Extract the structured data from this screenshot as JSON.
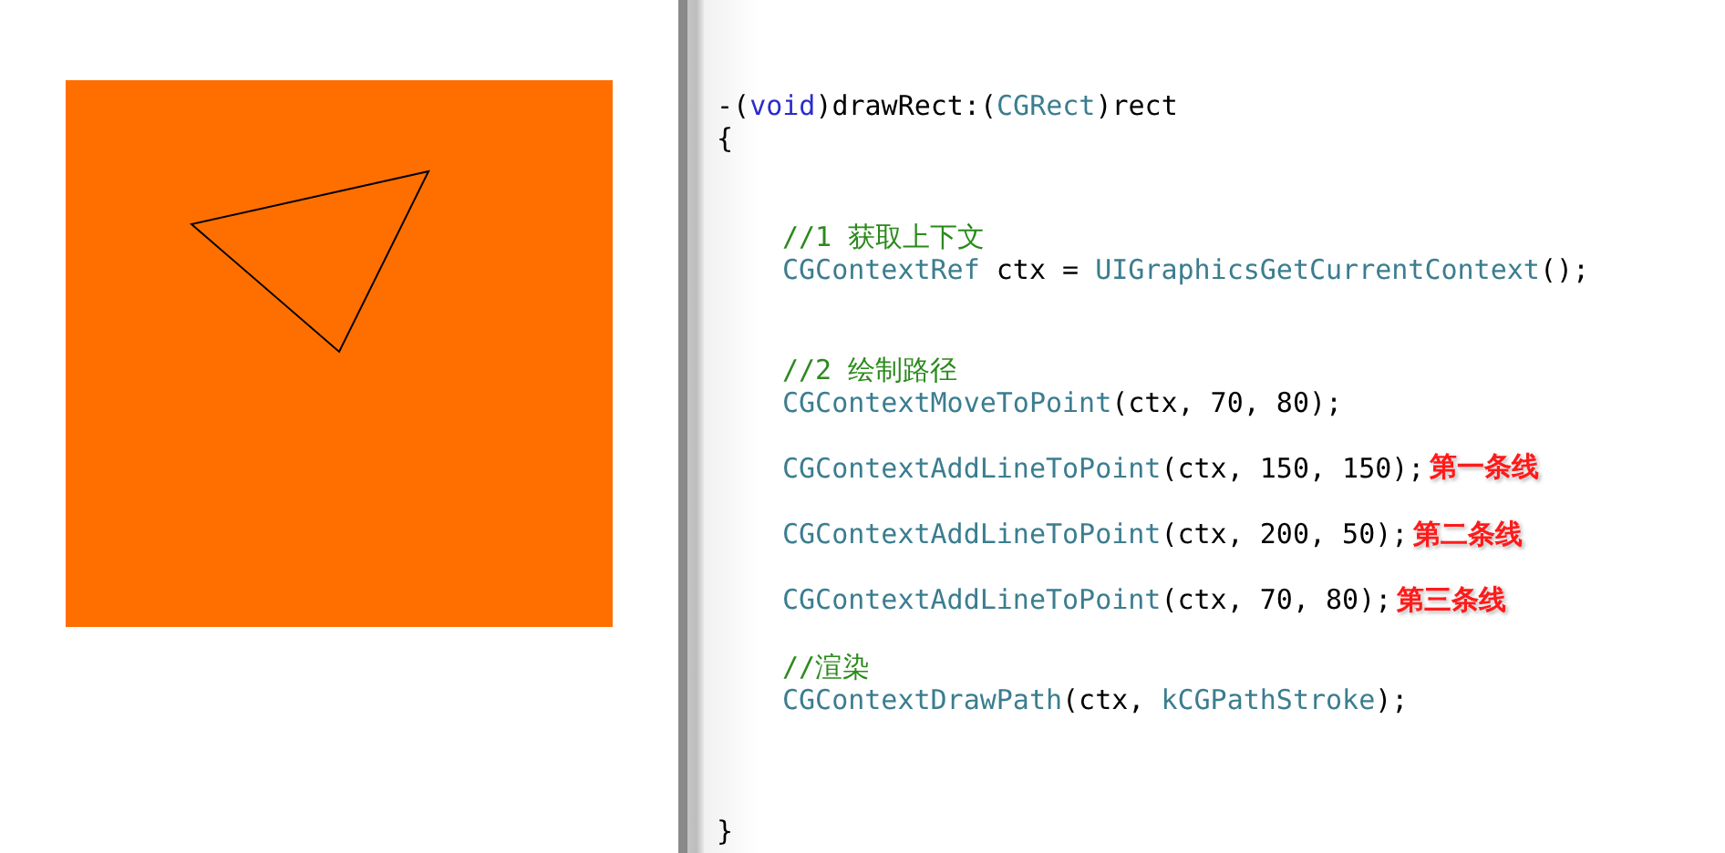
{
  "editor": {
    "lines": [
      {
        "kind": "code",
        "tokens": [
          {
            "kind": "plain",
            "text": "-("
          },
          {
            "kind": "keyword",
            "text": "void"
          },
          {
            "kind": "plain",
            "text": ")drawRect:("
          },
          {
            "kind": "type",
            "text": "CGRect"
          },
          {
            "kind": "plain",
            "text": ")rect"
          }
        ]
      },
      {
        "kind": "code",
        "tokens": [
          {
            "kind": "plain",
            "text": "{"
          }
        ],
        "children": [
          {
            "kind": "blank"
          },
          {
            "kind": "blank"
          },
          {
            "kind": "code",
            "tokens": [
              {
                "kind": "comment",
                "text": "//1 获取上下文"
              }
            ]
          },
          {
            "kind": "code",
            "tokens": [
              {
                "kind": "type",
                "text": "CGContextRef"
              },
              {
                "kind": "plain",
                "text": " ctx = "
              },
              {
                "kind": "type",
                "text": "UIGraphicsGetCurrentContext"
              },
              {
                "kind": "plain",
                "text": "();"
              }
            ]
          },
          {
            "kind": "blank"
          },
          {
            "kind": "blank"
          },
          {
            "kind": "code",
            "tokens": [
              {
                "kind": "comment",
                "text": "//2 绘制路径"
              }
            ]
          },
          {
            "kind": "code",
            "tokens": [
              {
                "kind": "type",
                "text": "CGContextMoveToPoint"
              },
              {
                "kind": "plain",
                "text": "(ctx, 70, 80);"
              }
            ]
          },
          {
            "kind": "blank"
          },
          {
            "kind": "code",
            "tokens": [
              {
                "kind": "type",
                "text": "CGContextAddLineToPoint"
              },
              {
                "kind": "plain",
                "text": "(ctx, 150, 150);"
              }
            ],
            "note": "第一条线"
          },
          {
            "kind": "blank"
          },
          {
            "kind": "code",
            "tokens": [
              {
                "kind": "type",
                "text": "CGContextAddLineToPoint"
              },
              {
                "kind": "plain",
                "text": "(ctx, 200, 50);"
              }
            ],
            "note": "第二条线"
          },
          {
            "kind": "blank"
          },
          {
            "kind": "code",
            "tokens": [
              {
                "kind": "type",
                "text": "CGContextAddLineToPoint"
              },
              {
                "kind": "plain",
                "text": "(ctx, 70, 80);"
              }
            ],
            "note": "第三条线"
          },
          {
            "kind": "blank"
          },
          {
            "kind": "code",
            "tokens": [
              {
                "kind": "comment",
                "text": "//渲染"
              }
            ]
          },
          {
            "kind": "code",
            "tokens": [
              {
                "kind": "type",
                "text": "CGContextDrawPath"
              },
              {
                "kind": "plain",
                "text": "(ctx, "
              },
              {
                "kind": "type",
                "text": "kCGPathStroke"
              },
              {
                "kind": "plain",
                "text": ");"
              }
            ]
          },
          {
            "kind": "blank"
          },
          {
            "kind": "blank"
          },
          {
            "kind": "blank"
          }
        ]
      },
      {
        "kind": "code",
        "tokens": [
          {
            "kind": "plain",
            "text": "}"
          }
        ]
      }
    ]
  }
}
